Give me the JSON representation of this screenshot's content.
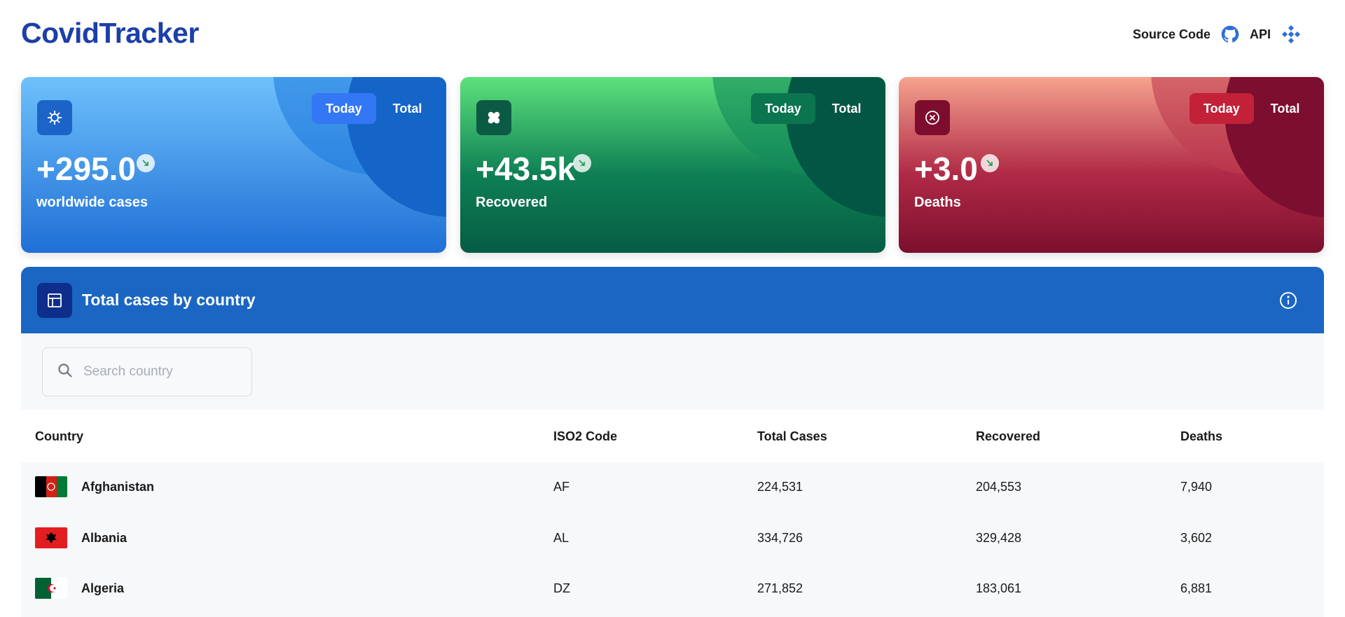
{
  "header": {
    "brand": "CovidTracker",
    "source_code_label": "Source Code",
    "api_label": "API"
  },
  "cards": [
    {
      "value": "+295.0",
      "label": "worldwide cases",
      "toggle_today": "Today",
      "toggle_total": "Total",
      "icon": "virus-icon"
    },
    {
      "value": "+43.5k",
      "label": "Recovered",
      "toggle_today": "Today",
      "toggle_total": "Total",
      "icon": "bandage-icon"
    },
    {
      "value": "+3.0",
      "label": "Deaths",
      "toggle_today": "Today",
      "toggle_total": "Total",
      "icon": "x-circle-icon"
    }
  ],
  "panel": {
    "title": "Total cases by country",
    "search_placeholder": "Search country"
  },
  "table": {
    "headers": [
      "Country",
      "ISO2 Code",
      "Total Cases",
      "Recovered",
      "Deaths"
    ],
    "rows": [
      {
        "country": "Afghanistan",
        "iso2": "AF",
        "total": "224,531",
        "recovered": "204,553",
        "deaths": "7,940"
      },
      {
        "country": "Albania",
        "iso2": "AL",
        "total": "334,726",
        "recovered": "329,428",
        "deaths": "3,602"
      },
      {
        "country": "Algeria",
        "iso2": "DZ",
        "total": "271,852",
        "recovered": "183,061",
        "deaths": "6,881"
      }
    ]
  },
  "colors": {
    "brand": "#1c3fa8",
    "panel_header": "#1a66c2",
    "cases": "#1f6fd6",
    "recovered": "#0f8055",
    "deaths": "#b02a46"
  }
}
